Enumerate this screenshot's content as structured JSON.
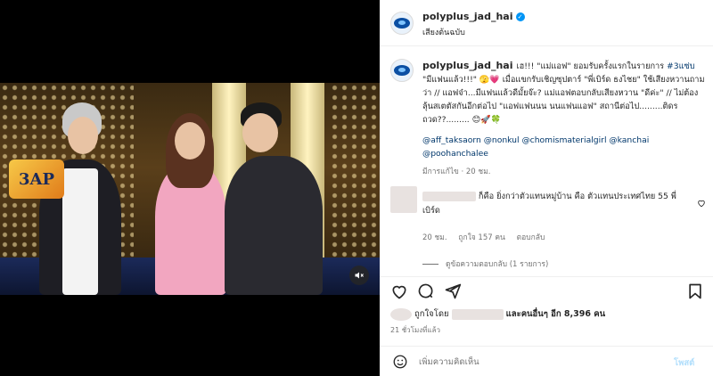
{
  "header": {
    "username": "polyplus_jad_hai",
    "subtitle": "เสียงต้นฉบับ"
  },
  "caption": {
    "username": "polyplus_jad_hai",
    "text_part1": "เฮ!!! \"แม่แอฟ\" ยอมรับครั้งแรกในรายการ ",
    "hashtag": "#3แซ่บ",
    "text_part2": " \"มีแฟนแล้ว!!!\" 🫣💗 เมื่อแขกรับเชิญซุปตาร์ \"พี่เบิร์ด ธงไชย\" ใช้เสียงหวานถามว่า // แอฟจ๋า...มีแฟนแล้วดีมั้ยจ๊ะ? แม่แอฟตอบกลับเสียงหวาน \"ดีค่ะ\" // ไม่ต้องลุ้นสเตตัสกันอีกต่อไป \"แอฟแฟนนน นนแฟนแอฟ\" สถานีต่อไป.........ติดรถวด??......... 😊🚀🍀",
    "mentions": "@aff_taksaorn @nonkul @chomismaterialgirl @kanchai @poohanchalee",
    "meta": "มีการแก้ไข · 20 ชม."
  },
  "comment": {
    "text": "ก็คือ ยิ่งกว่าตัวแทนหมู่บ้าน คือ ตัวแทนประเทศไทย 55 พี่เบิร์ด",
    "time": "20 ชม.",
    "likes": "ถูกใจ 157 คน",
    "reply_label": "ตอบกลับ",
    "view_replies": "ดูข้อความตอบกลับ (1 รายการ)"
  },
  "likes": {
    "prefix": "ถูกใจโดย",
    "suffix": "และคนอื่นๆ อีก 8,396 คน"
  },
  "time_ago": "21 ชั่วโมงที่แล้ว",
  "comment_box": {
    "placeholder": "เพิ่มความคิดเห็น",
    "post_label": "โพสต์"
  },
  "video": {
    "show_logo": "3AP",
    "muted": true
  },
  "icons": {
    "avatar": "polyplus-logo-icon",
    "verified": "verified-badge-icon",
    "like": "heart-icon",
    "comment": "comment-icon",
    "share": "send-icon",
    "save": "bookmark-icon",
    "emoji": "emoji-icon",
    "mute": "speaker-muted-icon"
  },
  "colors": {
    "link": "#00376b",
    "verified": "#0095f6",
    "post_button": "#b2dffc"
  }
}
